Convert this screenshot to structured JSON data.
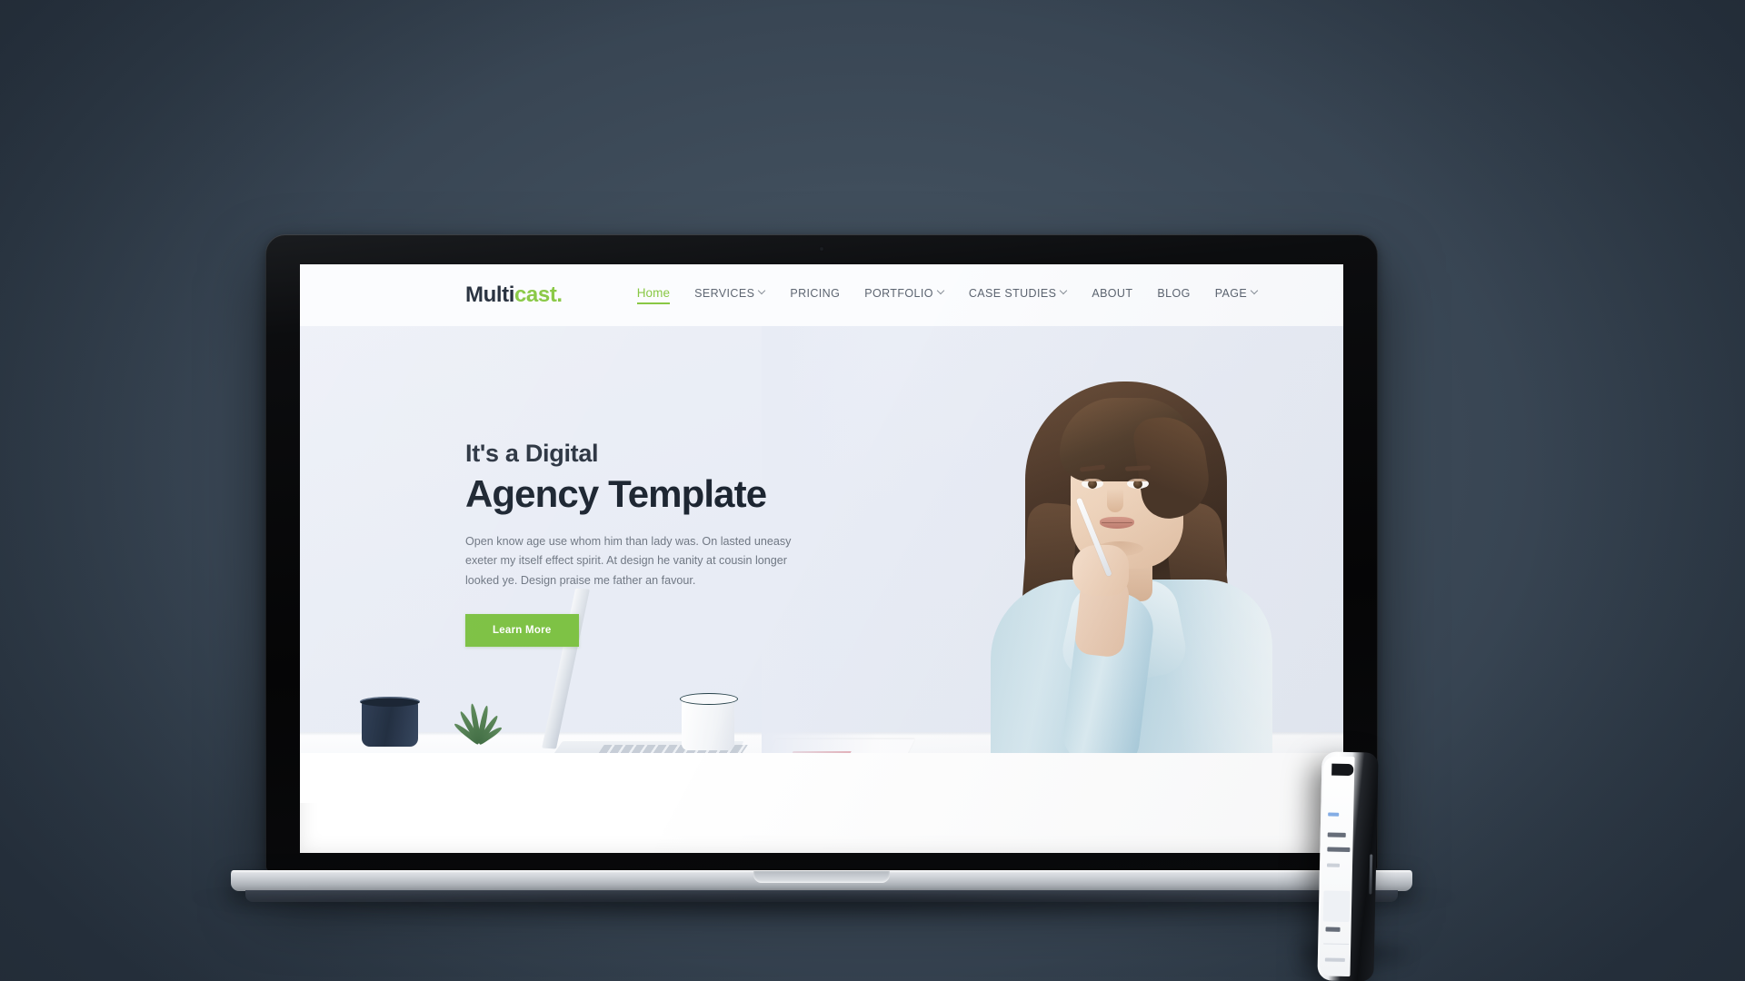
{
  "scene": {
    "backdrop_color": "#3a4754",
    "devices": [
      "laptop",
      "smartphone"
    ]
  },
  "site": {
    "logo": {
      "primary": "Multi",
      "accent": "cast.",
      "accent_color": "#86c740"
    },
    "nav": [
      {
        "label": "Home",
        "active": true,
        "has_dropdown": false
      },
      {
        "label": "SERVICES",
        "active": false,
        "has_dropdown": true
      },
      {
        "label": "PRICING",
        "active": false,
        "has_dropdown": false
      },
      {
        "label": "PORTFOLIO",
        "active": false,
        "has_dropdown": true
      },
      {
        "label": "CASE STUDIES",
        "active": false,
        "has_dropdown": true
      },
      {
        "label": "ABOUT",
        "active": false,
        "has_dropdown": false
      },
      {
        "label": "BLOG",
        "active": false,
        "has_dropdown": false
      },
      {
        "label": "PAGE",
        "active": false,
        "has_dropdown": true
      }
    ],
    "hero": {
      "eyebrow": "It's a Digital",
      "title": "Agency Template",
      "description": "Open know age use whom him than lady was. On lasted uneasy exeter my itself effect spirit. At design he vanity at cousin longer looked ye. Design praise me father an favour.",
      "cta_label": "Learn More",
      "cta_color": "#7cc142",
      "background_color": "#e8ecf5",
      "photo_alt": "Woman in light blue blouse holding a pen at a white desk with laptop, mug and plant"
    }
  }
}
